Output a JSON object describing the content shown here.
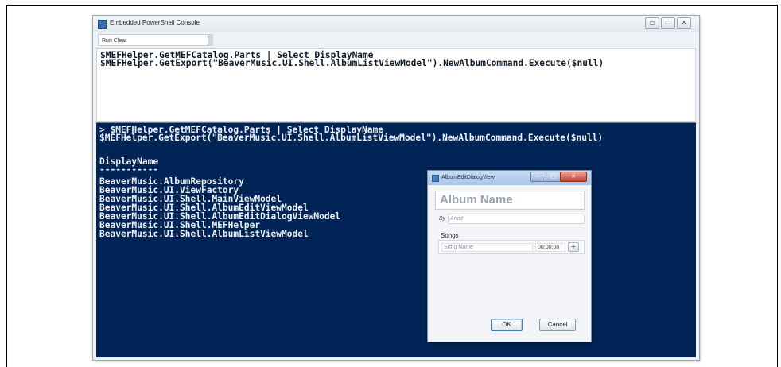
{
  "window": {
    "title": "Embedded PowerShell Console",
    "controls": {
      "minimize": "▭",
      "maximize": "▢",
      "close": "✕"
    }
  },
  "toolbar": {
    "run_clear_label": "Run Clear"
  },
  "input": {
    "lines": [
      "$MEFHelper.GetMEFCatalog.Parts | Select DisplayName",
      "$MEFHelper.GetExport(\"BeaverMusic.UI.Shell.AlbumListViewModel\").NewAlbumCommand.Execute($null)"
    ]
  },
  "console": {
    "command_lines": [
      "> $MEFHelper.GetMEFCatalog.Parts | Select DisplayName",
      "$MEFHelper.GetExport(\"BeaverMusic.UI.Shell.AlbumListViewModel\").NewAlbumCommand.Execute($null)"
    ],
    "header": "DisplayName",
    "separator": "-----------",
    "items": [
      "BeaverMusic.AlbumRepository",
      "BeaverMusic.UI.ViewFactory",
      "BeaverMusic.UI.Shell.MainViewModel",
      "BeaverMusic.UI.Shell.AlbumEditViewModel",
      "BeaverMusic.UI.Shell.AlbumEditDialogViewModel",
      "BeaverMusic.UI.Shell.MEFHelper",
      "BeaverMusic.UI.Shell.AlbumListViewModel"
    ]
  },
  "dialog": {
    "title": "AlbumEditDialogView",
    "album_name_placeholder": "Album Name",
    "by_label": "By",
    "artist_placeholder": "Artist",
    "songs_label": "Songs",
    "song_name_placeholder": "Song Name",
    "song_duration": "00:00:00",
    "add_song": "+",
    "ok_label": "OK",
    "cancel_label": "Cancel",
    "controls": {
      "minimize": "–",
      "maximize": "□",
      "close": "✕"
    }
  }
}
